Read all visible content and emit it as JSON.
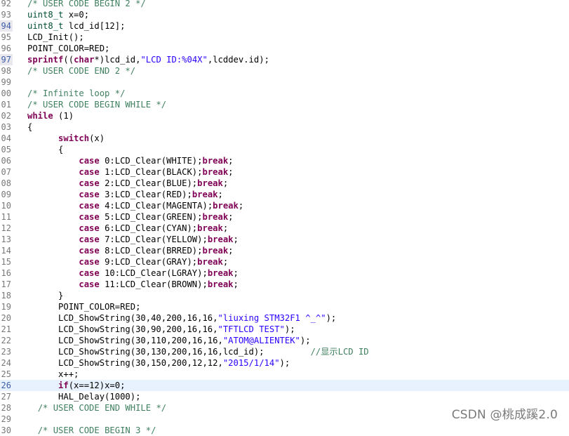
{
  "editor": {
    "lines": [
      {
        "n": "92",
        "tokens": [
          {
            "t": "/* USER CODE BEGIN 2 */",
            "c": "cm"
          }
        ]
      },
      {
        "n": "93",
        "tokens": [
          {
            "t": "uint8_t",
            "c": "dec"
          },
          {
            "t": " x=0;"
          }
        ]
      },
      {
        "n": "94",
        "mark": true,
        "tokens": [
          {
            "t": "uint8_t",
            "c": "dec"
          },
          {
            "t": " lcd_id[12];"
          }
        ]
      },
      {
        "n": "95",
        "tokens": [
          {
            "t": "LCD_Init();"
          }
        ]
      },
      {
        "n": "96",
        "tokens": [
          {
            "t": "POINT_COLOR=RED;"
          }
        ]
      },
      {
        "n": "97",
        "mark": true,
        "tokens": [
          {
            "t": "sprintf",
            "c": "kw"
          },
          {
            "t": "(("
          },
          {
            "t": "char",
            "c": "kw"
          },
          {
            "t": "*)lcd_id,"
          },
          {
            "t": "\"LCD ID:%04X\"",
            "c": "str"
          },
          {
            "t": ",lcddev.id);"
          }
        ]
      },
      {
        "n": "98",
        "tokens": [
          {
            "t": "/* USER CODE END 2 */",
            "c": "cm"
          }
        ]
      },
      {
        "n": "99",
        "tokens": []
      },
      {
        "n": "00",
        "tokens": [
          {
            "t": "/* Infinite loop */",
            "c": "cm"
          }
        ]
      },
      {
        "n": "01",
        "tokens": [
          {
            "t": "/* USER CODE BEGIN WHILE */",
            "c": "cm"
          }
        ]
      },
      {
        "n": "02",
        "tokens": [
          {
            "t": "while",
            "c": "kw"
          },
          {
            "t": " (1)"
          }
        ]
      },
      {
        "n": "03",
        "tokens": [
          {
            "t": "{"
          }
        ]
      },
      {
        "n": "04",
        "tokens": [
          {
            "t": "      "
          },
          {
            "t": "switch",
            "c": "kw"
          },
          {
            "t": "(x)"
          }
        ]
      },
      {
        "n": "05",
        "tokens": [
          {
            "t": "      {"
          }
        ]
      },
      {
        "n": "06",
        "tokens": [
          {
            "t": "          "
          },
          {
            "t": "case",
            "c": "kw"
          },
          {
            "t": " 0:LCD_Clear(WHITE);"
          },
          {
            "t": "break",
            "c": "kw"
          },
          {
            "t": ";"
          }
        ]
      },
      {
        "n": "07",
        "tokens": [
          {
            "t": "          "
          },
          {
            "t": "case",
            "c": "kw"
          },
          {
            "t": " 1:LCD_Clear(BLACK);"
          },
          {
            "t": "break",
            "c": "kw"
          },
          {
            "t": ";"
          }
        ]
      },
      {
        "n": "08",
        "tokens": [
          {
            "t": "          "
          },
          {
            "t": "case",
            "c": "kw"
          },
          {
            "t": " 2:LCD_Clear(BLUE);"
          },
          {
            "t": "break",
            "c": "kw"
          },
          {
            "t": ";"
          }
        ]
      },
      {
        "n": "09",
        "tokens": [
          {
            "t": "          "
          },
          {
            "t": "case",
            "c": "kw"
          },
          {
            "t": " 3:LCD_Clear(RED);"
          },
          {
            "t": "break",
            "c": "kw"
          },
          {
            "t": ";"
          }
        ]
      },
      {
        "n": "10",
        "tokens": [
          {
            "t": "          "
          },
          {
            "t": "case",
            "c": "kw"
          },
          {
            "t": " 4:LCD_Clear(MAGENTA);"
          },
          {
            "t": "break",
            "c": "kw"
          },
          {
            "t": ";"
          }
        ]
      },
      {
        "n": "11",
        "tokens": [
          {
            "t": "          "
          },
          {
            "t": "case",
            "c": "kw"
          },
          {
            "t": " 5:LCD_Clear(GREEN);"
          },
          {
            "t": "break",
            "c": "kw"
          },
          {
            "t": ";"
          }
        ]
      },
      {
        "n": "12",
        "tokens": [
          {
            "t": "          "
          },
          {
            "t": "case",
            "c": "kw"
          },
          {
            "t": " 6:LCD_Clear(CYAN);"
          },
          {
            "t": "break",
            "c": "kw"
          },
          {
            "t": ";"
          }
        ]
      },
      {
        "n": "13",
        "tokens": [
          {
            "t": "          "
          },
          {
            "t": "case",
            "c": "kw"
          },
          {
            "t": " 7:LCD_Clear(YELLOW);"
          },
          {
            "t": "break",
            "c": "kw"
          },
          {
            "t": ";"
          }
        ]
      },
      {
        "n": "14",
        "tokens": [
          {
            "t": "          "
          },
          {
            "t": "case",
            "c": "kw"
          },
          {
            "t": " 8:LCD_Clear(BRRED);"
          },
          {
            "t": "break",
            "c": "kw"
          },
          {
            "t": ";"
          }
        ]
      },
      {
        "n": "15",
        "tokens": [
          {
            "t": "          "
          },
          {
            "t": "case",
            "c": "kw"
          },
          {
            "t": " 9:LCD_Clear(GRAY);"
          },
          {
            "t": "break",
            "c": "kw"
          },
          {
            "t": ";"
          }
        ]
      },
      {
        "n": "16",
        "tokens": [
          {
            "t": "          "
          },
          {
            "t": "case",
            "c": "kw"
          },
          {
            "t": " 10:LCD_Clear(LGRAY);"
          },
          {
            "t": "break",
            "c": "kw"
          },
          {
            "t": ";"
          }
        ]
      },
      {
        "n": "17",
        "tokens": [
          {
            "t": "          "
          },
          {
            "t": "case",
            "c": "kw"
          },
          {
            "t": " 11:LCD_Clear(BROWN);"
          },
          {
            "t": "break",
            "c": "kw"
          },
          {
            "t": ";"
          }
        ]
      },
      {
        "n": "18",
        "tokens": [
          {
            "t": "      }"
          }
        ]
      },
      {
        "n": "19",
        "tokens": [
          {
            "t": "      POINT_COLOR=RED;"
          }
        ]
      },
      {
        "n": "20",
        "tokens": [
          {
            "t": "      LCD_ShowString(30,40,200,16,16,"
          },
          {
            "t": "\"liuxing STM32F1 ^_^\"",
            "c": "str"
          },
          {
            "t": ");"
          }
        ]
      },
      {
        "n": "21",
        "tokens": [
          {
            "t": "      LCD_ShowString(30,90,200,16,16,"
          },
          {
            "t": "\"TFTLCD TEST\"",
            "c": "str"
          },
          {
            "t": ");"
          }
        ]
      },
      {
        "n": "22",
        "tokens": [
          {
            "t": "      LCD_ShowString(30,110,200,16,16,"
          },
          {
            "t": "\"ATOM@ALIENTEK\"",
            "c": "str"
          },
          {
            "t": ");"
          }
        ]
      },
      {
        "n": "23",
        "tokens": [
          {
            "t": "      LCD_ShowString(30,130,200,16,16,lcd_id);         "
          },
          {
            "t": "//显示LCD ID",
            "c": "cm"
          }
        ]
      },
      {
        "n": "24",
        "tokens": [
          {
            "t": "      LCD_ShowString(30,150,200,12,12,"
          },
          {
            "t": "\"2015/1/14\"",
            "c": "str"
          },
          {
            "t": ");"
          }
        ]
      },
      {
        "n": "25",
        "tokens": [
          {
            "t": "      x++;"
          }
        ]
      },
      {
        "n": "26",
        "current": true,
        "tokens": [
          {
            "t": "      "
          },
          {
            "t": "if",
            "c": "kw"
          },
          {
            "t": "(x==12)x=0;"
          }
        ]
      },
      {
        "n": "27",
        "tokens": [
          {
            "t": "      HAL_Delay(1000);"
          }
        ]
      },
      {
        "n": "28",
        "tokens": [
          {
            "t": "  "
          },
          {
            "t": "/* USER CODE END WHILE */",
            "c": "cm"
          }
        ]
      },
      {
        "n": "29",
        "tokens": []
      },
      {
        "n": "30",
        "tokens": [
          {
            "t": "  "
          },
          {
            "t": "/* USER CODE BEGIN 3 */",
            "c": "cm"
          }
        ]
      }
    ]
  },
  "watermark": "CSDN @桃成蹊2.0"
}
